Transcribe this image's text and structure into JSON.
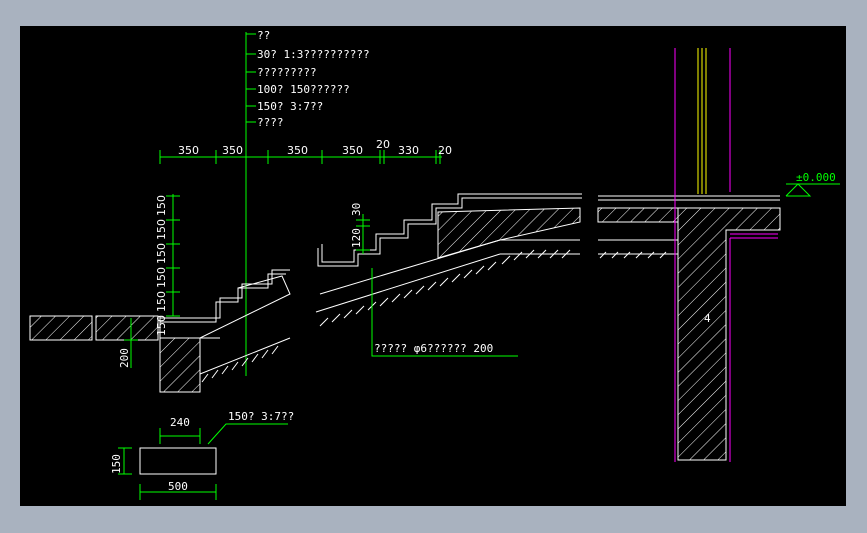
{
  "drawing": {
    "leader_labels": [
      "??",
      "30? 1:3??????????",
      "?????????",
      "100? 150??????",
      "150? 3:7??",
      "????"
    ],
    "top_dimensions": [
      "350",
      "350",
      "350",
      "350",
      "20",
      "330",
      "20"
    ],
    "vertical_dimensions": [
      "150",
      "150",
      "150",
      "150",
      "150",
      "150"
    ],
    "left_dimension": "200",
    "step_dimensions": [
      "30",
      "120"
    ],
    "rebar_note": "?????  φ6??????  200",
    "elevation_mark": "±0.000",
    "footing_note": "150? 3:7??",
    "footing_width_top": "240",
    "footing_height": "150",
    "footing_width": "500",
    "wall_tag": "4",
    "colors": {
      "background": "#000000",
      "line": "#ffffff",
      "dimension": "#00ff00",
      "wall_line": "#ff00ff",
      "rebar": "#ffff00"
    }
  }
}
